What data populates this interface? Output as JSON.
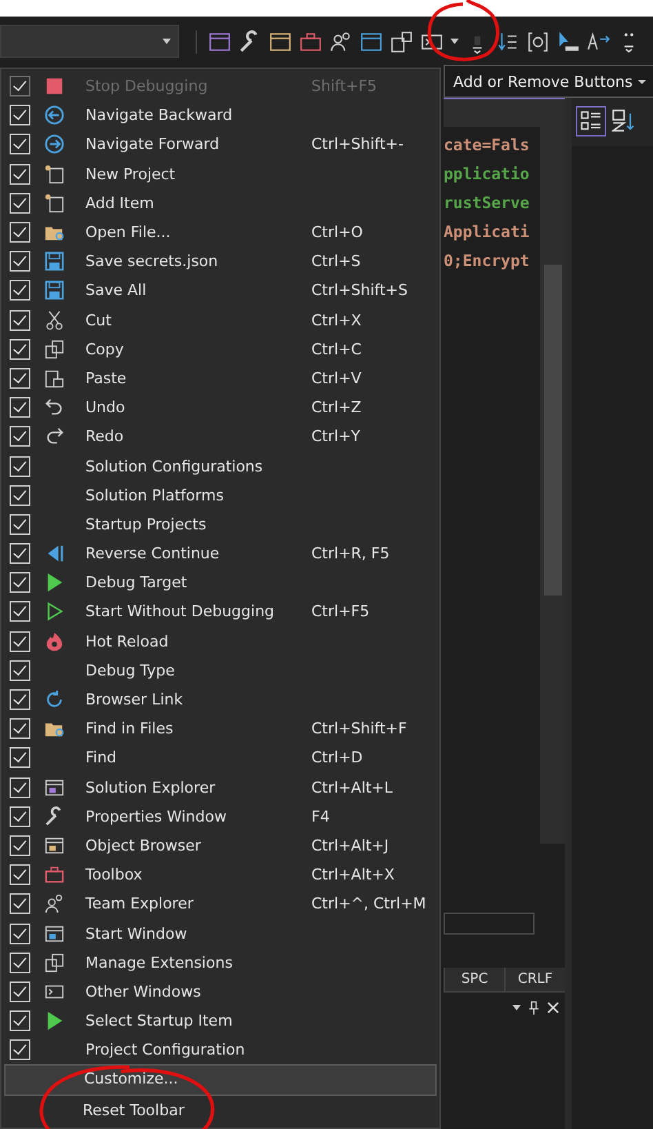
{
  "toolbar": {
    "add_remove_button": "Add or Remove Buttons"
  },
  "editor": {
    "lines": [
      {
        "text": "cate=Fals",
        "color": "#ce9178"
      },
      {
        "text": "pplicatio",
        "color": "#57a64a"
      },
      {
        "text": "rustServe",
        "color": "#57a64a"
      },
      {
        "text": "Applicati",
        "color": "#ce9178"
      },
      {
        "text": "0;Encrypt",
        "color": "#ce9178"
      }
    ]
  },
  "status_bar": [
    "SPC",
    "CRLF"
  ],
  "menu": {
    "items": [
      {
        "label": "Stop Debugging",
        "shortcut": "Shift+F5",
        "checked": true,
        "disabled": true
      },
      {
        "label": "Navigate Backward",
        "checked": true,
        "disabled": false
      },
      {
        "label": "Navigate Forward",
        "shortcut": "Ctrl+Shift+-",
        "checked": true,
        "disabled": false
      },
      {
        "label": "New Project",
        "checked": true,
        "disabled": false
      },
      {
        "label": "Add Item",
        "checked": true,
        "disabled": false
      },
      {
        "label": "Open File...",
        "shortcut": "Ctrl+O",
        "checked": true,
        "disabled": false
      },
      {
        "label": "Save secrets.json",
        "shortcut": "Ctrl+S",
        "checked": true,
        "disabled": false
      },
      {
        "label": "Save All",
        "shortcut": "Ctrl+Shift+S",
        "checked": true,
        "disabled": false
      },
      {
        "label": "Cut",
        "shortcut": "Ctrl+X",
        "checked": true,
        "disabled": false
      },
      {
        "label": "Copy",
        "shortcut": "Ctrl+C",
        "checked": true,
        "disabled": false
      },
      {
        "label": "Paste",
        "shortcut": "Ctrl+V",
        "checked": true,
        "disabled": false
      },
      {
        "label": "Undo",
        "shortcut": "Ctrl+Z",
        "checked": true,
        "disabled": false
      },
      {
        "label": "Redo",
        "shortcut": "Ctrl+Y",
        "checked": true,
        "disabled": false
      },
      {
        "label": "Solution Configurations",
        "checked": true,
        "disabled": false
      },
      {
        "label": "Solution Platforms",
        "checked": true,
        "disabled": false
      },
      {
        "label": "Startup Projects",
        "checked": true,
        "disabled": false
      },
      {
        "label": "Reverse Continue",
        "shortcut": "Ctrl+R, F5",
        "checked": true,
        "disabled": false
      },
      {
        "label": "Debug Target",
        "checked": true,
        "disabled": false
      },
      {
        "label": "Start Without Debugging",
        "shortcut": "Ctrl+F5",
        "checked": true,
        "disabled": false
      },
      {
        "label": "Hot Reload",
        "checked": true,
        "disabled": false
      },
      {
        "label": "Debug Type",
        "checked": true,
        "disabled": false
      },
      {
        "label": "Browser Link",
        "checked": true,
        "disabled": false
      },
      {
        "label": "Find in Files",
        "shortcut": "Ctrl+Shift+F",
        "checked": true,
        "disabled": false
      },
      {
        "label": "Find",
        "shortcut": "Ctrl+D",
        "checked": true,
        "disabled": false
      },
      {
        "label": "Solution Explorer",
        "shortcut": "Ctrl+Alt+L",
        "checked": true,
        "disabled": false
      },
      {
        "label": "Properties Window",
        "shortcut": "F4",
        "checked": true,
        "disabled": false
      },
      {
        "label": "Object Browser",
        "shortcut": "Ctrl+Alt+J",
        "checked": true,
        "disabled": false
      },
      {
        "label": "Toolbox",
        "shortcut": "Ctrl+Alt+X",
        "checked": true,
        "disabled": false
      },
      {
        "label": "Team Explorer",
        "shortcut": "Ctrl+^, Ctrl+M",
        "checked": true,
        "disabled": false
      },
      {
        "label": "Start Window",
        "checked": true,
        "disabled": false
      },
      {
        "label": "Manage Extensions",
        "checked": true,
        "disabled": false
      },
      {
        "label": "Other Windows",
        "checked": true,
        "disabled": false
      },
      {
        "label": "Select Startup Item",
        "checked": true,
        "disabled": false
      },
      {
        "label": "Project Configuration",
        "checked": true,
        "disabled": false
      }
    ],
    "commands": [
      {
        "label": "Customize...",
        "selected": true
      },
      {
        "label": "Reset Toolbar",
        "selected": false
      }
    ]
  }
}
